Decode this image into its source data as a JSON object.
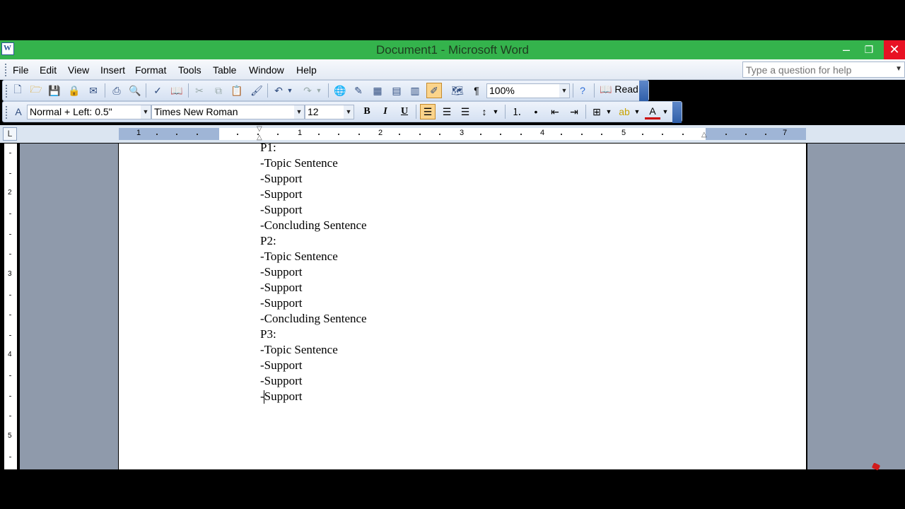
{
  "window": {
    "title": "Document1 - Microsoft Word",
    "icon_letter": "W"
  },
  "menu": [
    "File",
    "Edit",
    "View",
    "Insert",
    "Format",
    "Tools",
    "Table",
    "Window",
    "Help"
  ],
  "help_box": {
    "placeholder": "Type a question for help"
  },
  "standard_toolbar": {
    "zoom": "100%",
    "read_label": "Read"
  },
  "formatting_toolbar": {
    "style": "Normal + Left:  0.5\"",
    "font": "Times New Roman",
    "size": "12",
    "bold": "B",
    "italic": "I",
    "underline": "U"
  },
  "ruler": {
    "numbers": [
      "1",
      "1",
      "2",
      "3",
      "4",
      "5",
      "7"
    ],
    "vertical_numbers": [
      "2",
      "3",
      "4",
      "5"
    ]
  },
  "document": {
    "lines": [
      "P1:",
      "-Topic Sentence",
      "-Support",
      "-Support",
      "-Support",
      "-Concluding Sentence",
      "P2:",
      "-Topic Sentence",
      "-Support",
      "-Support",
      "-Support",
      "-Concluding Sentence",
      "P3:",
      "-Topic Sentence",
      "-Support",
      "-Support",
      "-Support"
    ]
  },
  "colors": {
    "titlebar": "#34b34c",
    "workspace": "#8f9aab",
    "close": "#e81123"
  }
}
